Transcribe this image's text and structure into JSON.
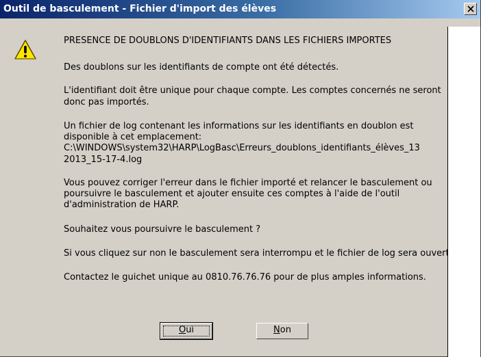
{
  "window": {
    "title": "Outil de basculement - Fichier d'import des élèves",
    "close_icon": "close-icon"
  },
  "message": {
    "icon": "warning-icon",
    "heading": "PRESENCE DE DOUBLONS D'IDENTIFIANTS DANS LES FICHIERS IMPORTES",
    "lines": [
      "Des doublons sur les identifiants de compte ont été détectés.",
      "L'identifiant doit être unique pour chaque compte. Les comptes concernés ne seront",
      "donc pas importés.",
      "Un fichier de log contenant les informations sur les identifiants en doublon est",
      "disponible à cet emplacement:",
      "C:\\WINDOWS\\system32\\HARP\\LogBasc\\Erreurs_doublons_identifiants_élèves_13",
      "2013_15-17-4.log",
      "Vous pouvez corriger l'erreur dans le fichier importé et relancer le basculement ou",
      "poursuivre le basculement et ajouter ensuite ces comptes à l'aide de l'outil",
      "d'administration de HARP.",
      "Souhaitez vous poursuivre le basculement ?",
      "Si vous cliquez sur non le basculement sera interrompu et le fichier de log sera ouvert",
      "Contactez le guichet unique au 0810.76.76.76 pour de plus amples informations."
    ]
  },
  "buttons": {
    "yes": {
      "mnemonic": "O",
      "rest": "ui"
    },
    "no": {
      "mnemonic": "N",
      "rest": "on"
    }
  }
}
